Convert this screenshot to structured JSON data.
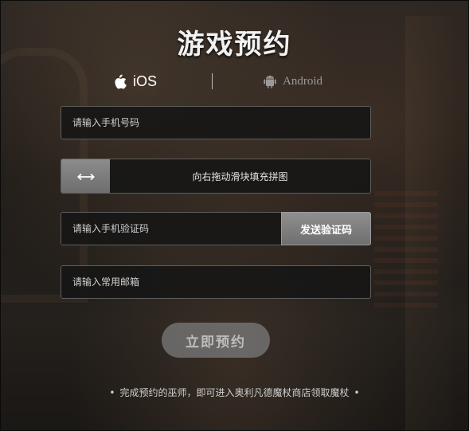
{
  "title": "游戏预约",
  "platforms": {
    "ios": {
      "label": "iOS",
      "icon": "apple-icon"
    },
    "android": {
      "label": "Android",
      "icon": "android-icon"
    }
  },
  "form": {
    "phone": {
      "placeholder": "请输入手机号码",
      "value": ""
    },
    "slider": {
      "label": "向右拖动滑块填充拼图",
      "icon": "double-arrow-icon"
    },
    "code": {
      "placeholder": "请输入手机验证码",
      "value": "",
      "send_label": "发送验证码"
    },
    "email": {
      "placeholder": "请输入常用邮箱",
      "value": ""
    },
    "submit_label": "立即预约"
  },
  "footer": {
    "bullet": "•",
    "note": "完成预约的巫师，即可进入奥利凡德魔杖商店领取魔杖"
  },
  "colors": {
    "field_bg": "#161616",
    "field_border": "#5e5e5e",
    "button_gray": "#7f7f7f",
    "inactive_platform": "#9a9a9a"
  }
}
